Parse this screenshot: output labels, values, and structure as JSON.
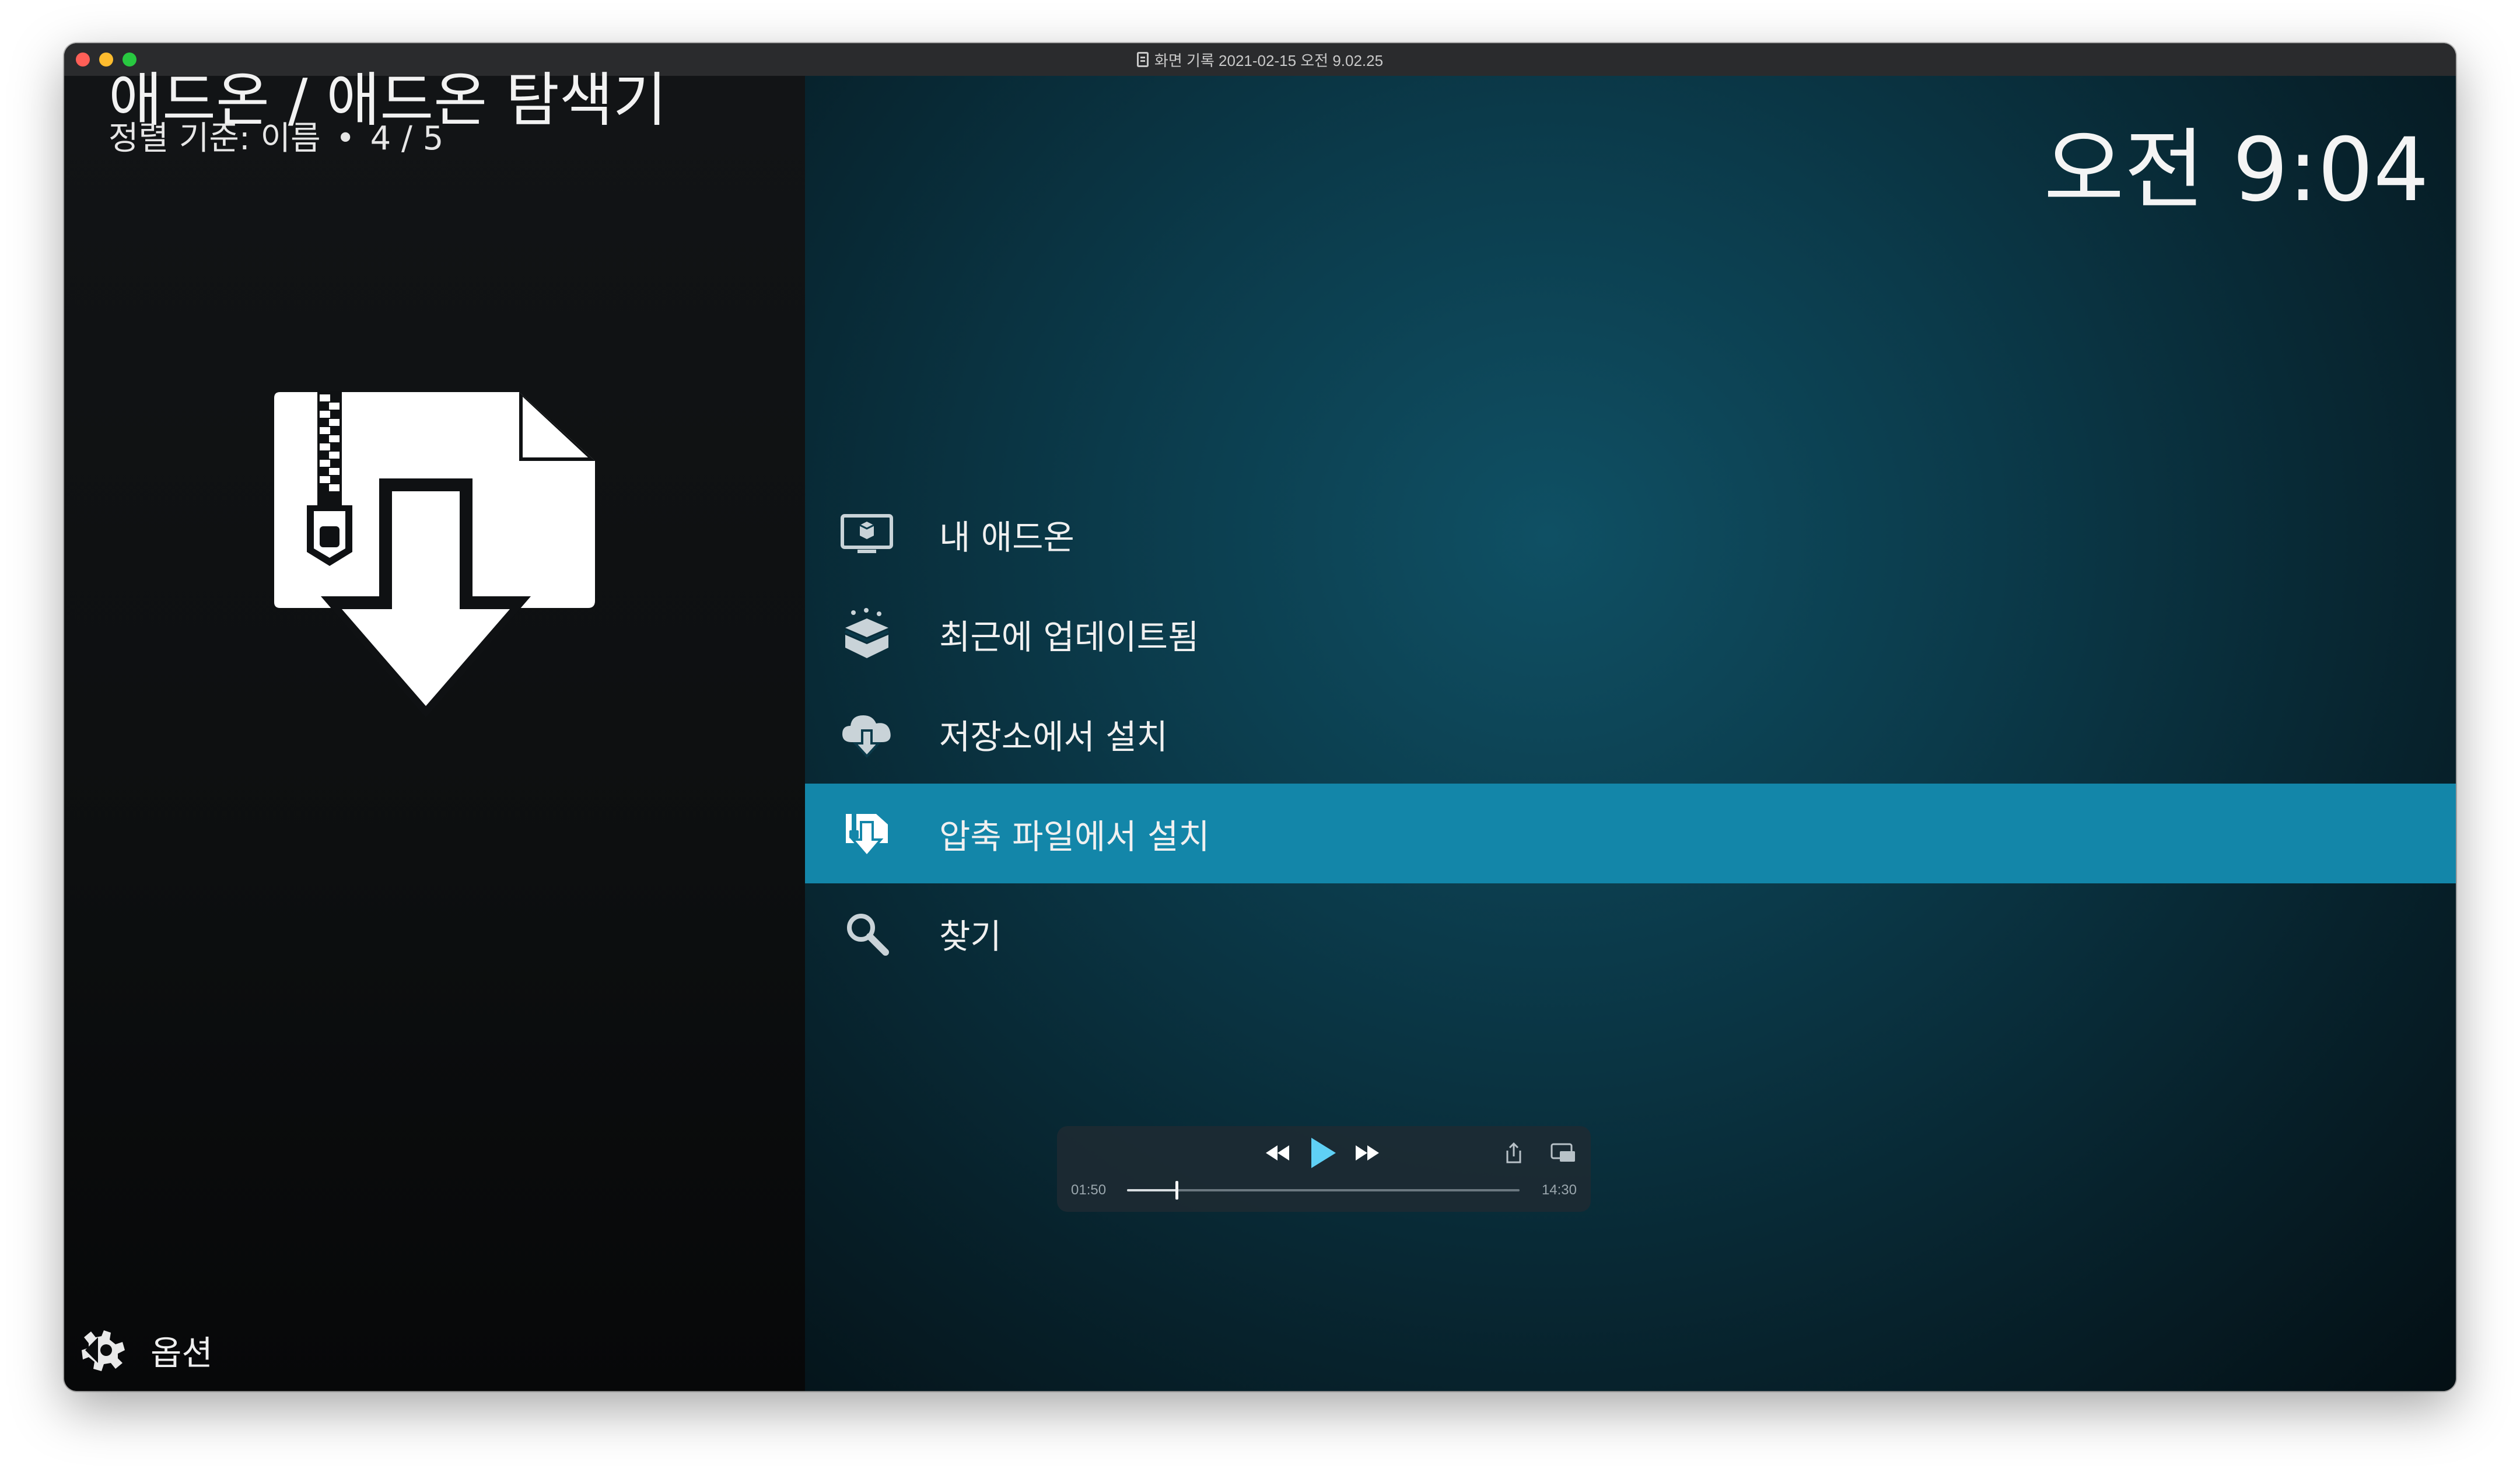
{
  "window": {
    "title": "화면 기록 2021-02-15 오전 9.02.25"
  },
  "header": {
    "title": "애드온 / 애드온 탐색기",
    "sort_label": "정렬 기준: 이름",
    "separator": "•",
    "position": "4 / 5",
    "clock": "오전 9:04"
  },
  "feature_icon": "zip-download-icon",
  "menu": {
    "selected_index": 3,
    "items": [
      {
        "label": "내 애드온",
        "icon": "monitor-box-icon"
      },
      {
        "label": "최근에 업데이트됨",
        "icon": "open-box-icon"
      },
      {
        "label": "저장소에서 설치",
        "icon": "cloud-download-icon"
      },
      {
        "label": "압축 파일에서 설치",
        "icon": "zip-install-icon"
      },
      {
        "label": "찾기",
        "icon": "search-icon"
      }
    ]
  },
  "player": {
    "elapsed": "01:50",
    "total": "14:30",
    "progress": 0.126
  },
  "footer": {
    "options_label": "옵션"
  },
  "colors": {
    "accent": "#1386a9",
    "left_panel": "#0f1113",
    "right_panel": "#0b3a4a"
  }
}
